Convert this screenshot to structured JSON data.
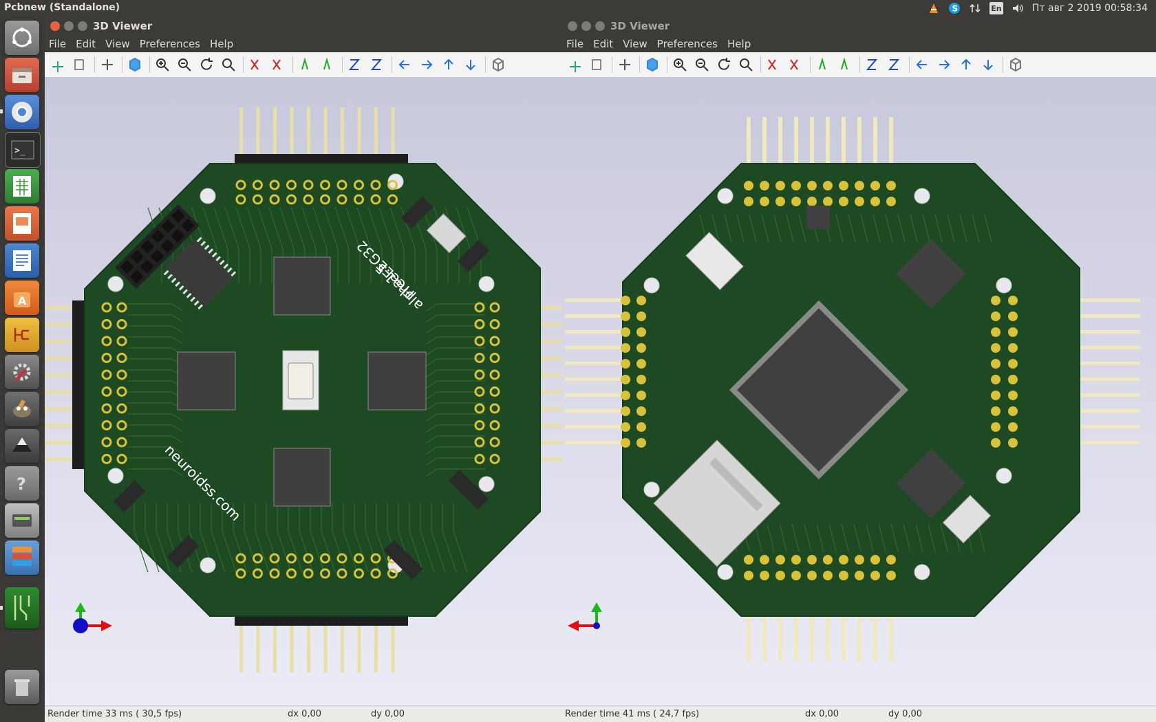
{
  "topbar": {
    "app_title": "Pcbnew (Standalone)",
    "keyboard_layout": "En",
    "clock": "Пт авг  2 2019 00:58:34"
  },
  "launcher": {
    "apps": [
      "ubuntu-dash",
      "files",
      "chromium",
      "terminal",
      "calc",
      "impress",
      "writer",
      "software-center",
      "kicad-eeschema",
      "settings",
      "gimp",
      "inkscape",
      "help",
      "disks",
      "stack",
      "kicad-pcbnew"
    ]
  },
  "left_window": {
    "title": "3D Viewer",
    "menu": [
      "File",
      "Edit",
      "View",
      "Preferences",
      "Help"
    ],
    "status": {
      "render": "Render time 33 ms ( 30,5 fps)",
      "dx": "dx 0,00",
      "dy": "dy 0,00"
    },
    "board": {
      "name": "FreeEEG32",
      "version": "alpha1.5",
      "site": "neuroidss.com"
    }
  },
  "right_window": {
    "title": "3D Viewer",
    "menu": [
      "File",
      "Edit",
      "View",
      "Preferences",
      "Help"
    ],
    "status": {
      "render": "Render time 41 ms ( 24,7 fps)",
      "dx": "dx 0,00",
      "dy": "dy 0,00"
    }
  },
  "colors": {
    "pcb": "#1d4a22",
    "trace": "#2f6b2a",
    "pad_gold": "#d8c23a",
    "header_black": "#1e1e1e",
    "pin": "#e8dfa8"
  }
}
